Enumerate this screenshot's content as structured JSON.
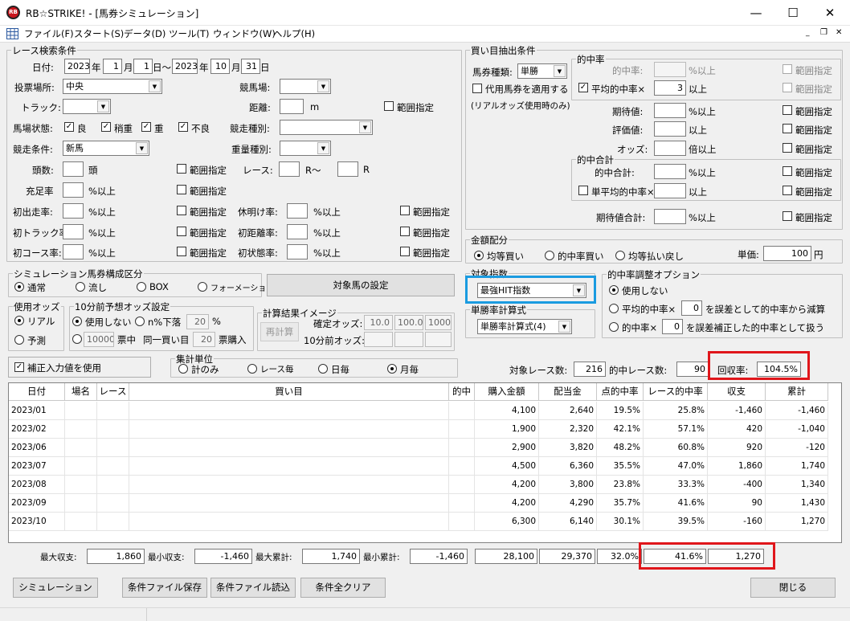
{
  "window": {
    "title": "RB☆STRIKE! - [馬券シミュレーション]",
    "icon": "rb-strike-logo-icon",
    "icon_text": "RB",
    "minimize": "—",
    "maximize": "☐",
    "close": "✕"
  },
  "menu": {
    "items": [
      "ファイル(F)",
      "スタート(S)",
      "データ(D)",
      "ツール(T)",
      "ウィンドウ(W)",
      "ヘルプ(H)"
    ]
  },
  "race": {
    "group": "レース検索条件",
    "date_label": "日付:",
    "y1": "2023",
    "m1": "1",
    "d1": "1",
    "y2": "2023",
    "m2": "10",
    "d2": "31",
    "nen": "年",
    "tsuki": "月",
    "hi": "日",
    "tilde": "日〜",
    "venue_label": "投票場所:",
    "venue": "中央",
    "track_label": "競馬場:",
    "truck_label": "トラック:",
    "dist_label": "距離:",
    "dist_unit": "m",
    "range": "範囲指定",
    "cond_label": "馬場状態:",
    "cond": [
      "良",
      "稍重",
      "重",
      "不良"
    ],
    "kind_label": "競走種別:",
    "jouken_label": "競走条件:",
    "jouken": "新馬",
    "weight_label": "重量種別:",
    "heads_label": "頭数:",
    "heads_unit": "頭",
    "race_label": "レース:",
    "r_tilde": "R〜",
    "r": "R",
    "juutei_label": "充足率",
    "pct_over": "%以上",
    "first_run": "初出走率:",
    "kyuumei": "休明け率:",
    "first_track": "初トラック率:",
    "first_dist": "初距離率:",
    "first_course": "初コース率:",
    "first_cond": "初状態率:"
  },
  "buy": {
    "group": "買い目抽出条件",
    "type_label": "馬券種類:",
    "type": "単勝",
    "daiyou": "代用馬券を適用する",
    "real": "(リアルオッズ使用時のみ)",
    "hit": "的中率",
    "hit_rate": "的中率:",
    "pct_over": "%以上",
    "avg_hit": "平均的中率×",
    "avg_val": "3",
    "ijou": "以上",
    "expect": "期待値:",
    "hyouka": "評価値:",
    "odds": "オッズ:",
    "bai": "倍以上",
    "range": "範囲指定",
    "sum": "的中合計",
    "sum_hit": "的中合計:",
    "single_avg": "単平均的中率×",
    "expect_sum": "期待値合計:"
  },
  "money": {
    "group": "金額配分",
    "opts": [
      "均等買い",
      "的中率買い",
      "均等払い戻し"
    ],
    "unit_label": "単価:",
    "unit": "100",
    "yen": "円"
  },
  "sim": {
    "group": "シミュレーション馬券構成区分",
    "opts": [
      "通常",
      "流し",
      "BOX",
      "フォーメーション"
    ],
    "target_btn": "対象馬の設定"
  },
  "target": {
    "group": "対象指数",
    "value": "最強HIT指数"
  },
  "single": {
    "group": "単勝率計算式",
    "value": "単勝率計算式(4)"
  },
  "adjust": {
    "group": "的中率調整オプション",
    "opt1": "使用しない",
    "opt2a": "平均的中率×",
    "opt2v": "0",
    "opt2b": "を誤差として的中率から減算",
    "opt3a": "的中率×",
    "opt3v": "0",
    "opt3b": "を誤差補正した的中率として扱う"
  },
  "oddsuse": {
    "group": "使用オッズ",
    "opts": [
      "リアル",
      "予測"
    ]
  },
  "tenmin": {
    "group": "10分前予想オッズ設定",
    "opt1": "使用しない",
    "opt2": "n%下落",
    "n": "20",
    "pct": "%",
    "units": "10000",
    "hyou": "票中",
    "same": "同一買い目",
    "cnt": "20",
    "kounyu": "票購入"
  },
  "calc": {
    "group": "計算結果イメージ",
    "btn": "再計算",
    "fixed": "確定オッズ:",
    "ten": "10分前オッズ:",
    "v": [
      "10.0",
      "100.0",
      "1000"
    ]
  },
  "correct": {
    "label": "補正入力値を使用"
  },
  "agg": {
    "group": "集計単位",
    "opts": [
      "計のみ",
      "レース毎",
      "日毎",
      "月毎"
    ]
  },
  "summary": {
    "race_label": "対象レース数:",
    "race": "216",
    "hitrace_label": "的中レース数:",
    "hitrace": "90",
    "ret_label": "回収率:",
    "ret": "104.5%"
  },
  "table": {
    "headers": [
      "日付",
      "場名",
      "レース",
      "買い目",
      "的中",
      "購入金額",
      "配当金",
      "点的中率",
      "レース的中率",
      "収支",
      "累計"
    ],
    "rows": [
      [
        "2023/01",
        "",
        "",
        "",
        "",
        "4,100",
        "2,640",
        "19.5%",
        "25.8%",
        "-1,460",
        "-1,460"
      ],
      [
        "2023/02",
        "",
        "",
        "",
        "",
        "1,900",
        "2,320",
        "42.1%",
        "57.1%",
        "420",
        "-1,040"
      ],
      [
        "2023/06",
        "",
        "",
        "",
        "",
        "2,900",
        "3,820",
        "48.2%",
        "60.8%",
        "920",
        "-120"
      ],
      [
        "2023/07",
        "",
        "",
        "",
        "",
        "4,500",
        "6,360",
        "35.5%",
        "47.0%",
        "1,860",
        "1,740"
      ],
      [
        "2023/08",
        "",
        "",
        "",
        "",
        "4,200",
        "3,800",
        "23.8%",
        "33.3%",
        "-400",
        "1,340"
      ],
      [
        "2023/09",
        "",
        "",
        "",
        "",
        "4,200",
        "4,290",
        "35.7%",
        "41.6%",
        "90",
        "1,430"
      ],
      [
        "2023/10",
        "",
        "",
        "",
        "",
        "6,300",
        "6,140",
        "30.1%",
        "39.5%",
        "-160",
        "1,270"
      ]
    ]
  },
  "totals": {
    "max_inc_label": "最大収支:",
    "max_inc": "1,860",
    "min_inc_label": "最小収支:",
    "min_inc": "-1,460",
    "max_cum_label": "最大累計:",
    "max_cum": "1,740",
    "min_cum_label": "最小累計:",
    "min_cum": "-1,460",
    "buy": "28,100",
    "pay": "29,370",
    "pt": "32.0%",
    "race": "41.6%",
    "cum": "1,270"
  },
  "buttons": {
    "sim": "シミュレーション",
    "save": "条件ファイル保存",
    "load": "条件ファイル読込",
    "clear": "条件全クリア",
    "close": "閉じる"
  }
}
